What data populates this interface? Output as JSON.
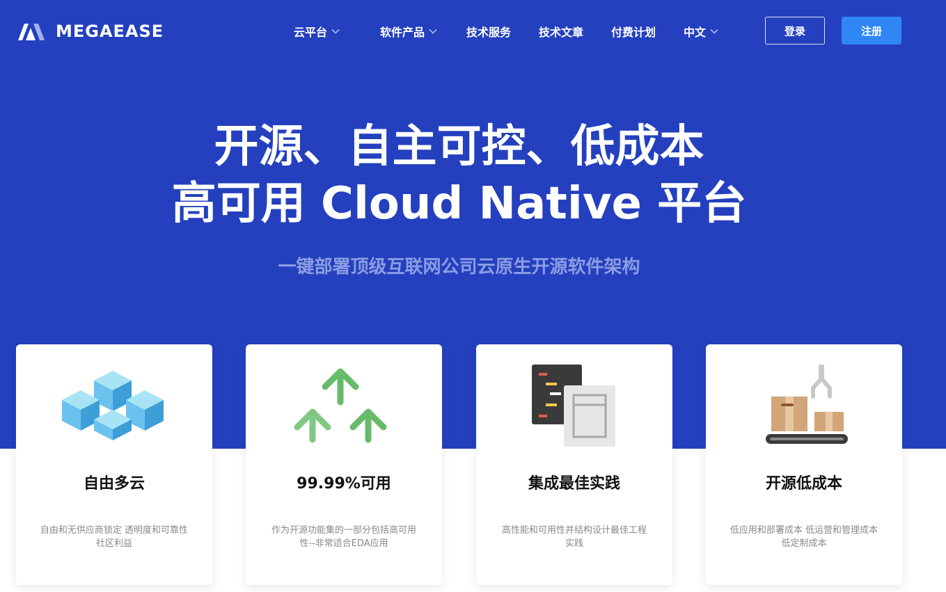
{
  "brand": {
    "name": "MEGAEASE",
    "colors": {
      "hero_bg": "#2440be",
      "accent_button": "#2f87f5",
      "subtitle": "#8b9de3"
    }
  },
  "nav": {
    "items": [
      {
        "label": "云平台",
        "has_dropdown": true
      },
      {
        "label": "软件产品",
        "has_dropdown": true
      },
      {
        "label": "技术服务",
        "has_dropdown": false
      },
      {
        "label": "技术文章",
        "has_dropdown": false
      },
      {
        "label": "付费计划",
        "has_dropdown": false
      },
      {
        "label": "中文",
        "has_dropdown": true
      }
    ],
    "login_label": "登录",
    "register_label": "注册"
  },
  "hero": {
    "title_line1": "开源、自主可控、低成本",
    "title_line2": "高可用 Cloud Native 平台",
    "subtitle": "一键部署顶级互联网公司云原生开源软件架构"
  },
  "features": [
    {
      "icon": "cubes-icon",
      "title": "自由多云",
      "desc_line1": "自由和无供应商锁定 透明度和可靠性",
      "desc_line2": "社区利益"
    },
    {
      "icon": "arrows-up-icon",
      "title": "99.99%可用",
      "desc_line1": "作为开源功能集的一部分包括高可用",
      "desc_line2": "性--非常适合EDA应用"
    },
    {
      "icon": "documents-icon",
      "title": "集成最佳实践",
      "desc_line1": "高性能和可用性并结构设计最佳工程",
      "desc_line2": "实践"
    },
    {
      "icon": "conveyor-boxes-icon",
      "title": "开源低成本",
      "desc_line1": "低应用和部署成本 低运营和管理成本",
      "desc_line2": "低定制成本"
    }
  ]
}
